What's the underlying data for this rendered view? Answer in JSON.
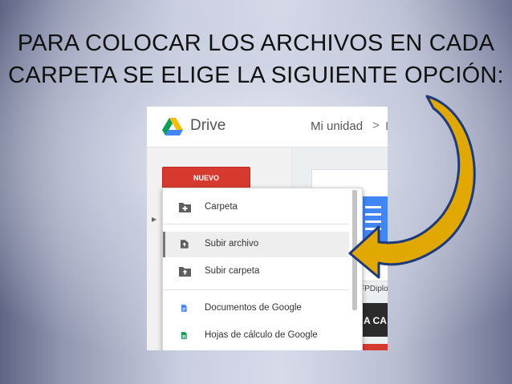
{
  "slide": {
    "title_line1": "PARA COLOCAR LOS ARCHIVOS EN CADA",
    "title_line2": "CARPETA SE ELIGE LA SIGUIENTE OPCIÓN:"
  },
  "drive": {
    "app_name": "Drive",
    "breadcrumb": "Mi unidad",
    "breadcrumb_sep": ">",
    "breadcrumb_cut": "I",
    "new_button": "NUEVO",
    "file_label": "FPDiplo",
    "dark_card_text": "A CA"
  },
  "menu": {
    "items": [
      {
        "label": "Carpeta",
        "icon": "folder-plus-icon"
      },
      {
        "label": "Subir archivo",
        "icon": "file-upload-icon"
      },
      {
        "label": "Subir carpeta",
        "icon": "folder-upload-icon"
      },
      {
        "label": "Documentos de Google",
        "icon": "google-docs-icon"
      },
      {
        "label": "Hojas de cálculo de Google",
        "icon": "google-sheets-icon"
      }
    ],
    "highlighted_index": 1
  },
  "colors": {
    "arrow_fill": "#e0a800",
    "arrow_stroke": "#1f3a7a",
    "new_button": "#d63a2f",
    "docs_blue": "#4285f4",
    "sheets_green": "#0f9d58"
  }
}
